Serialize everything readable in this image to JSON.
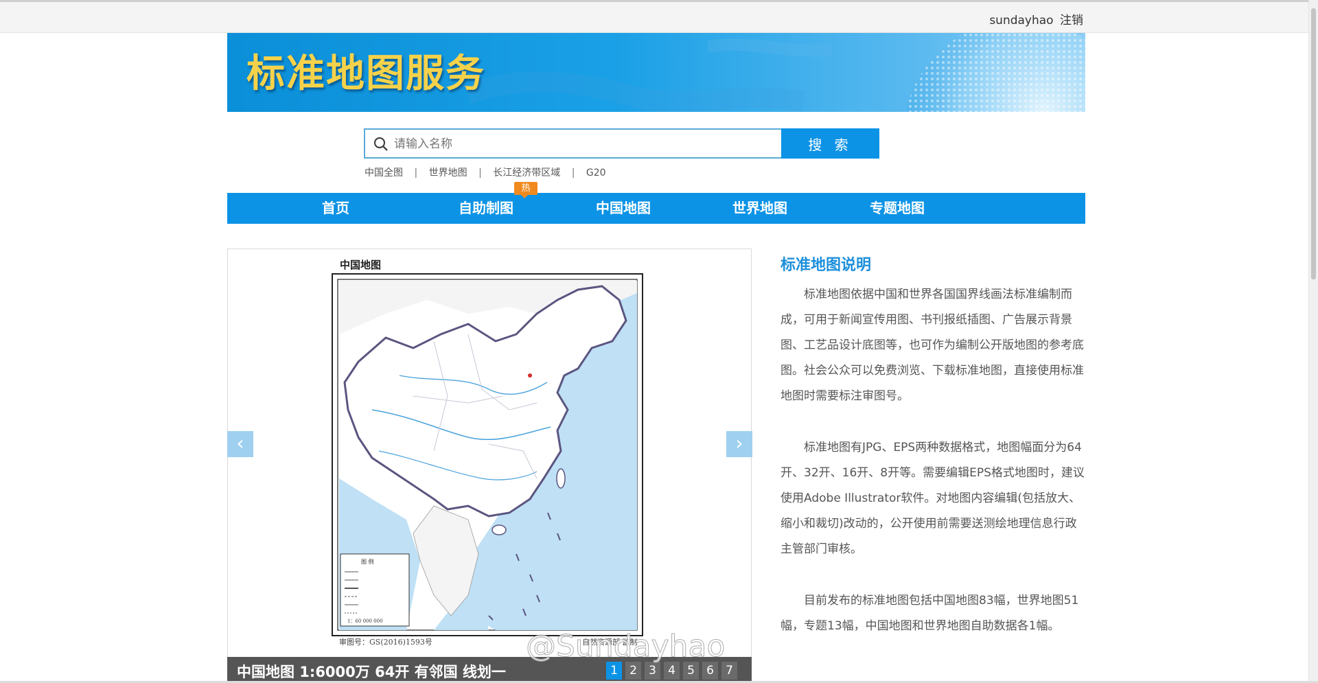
{
  "topbar": {
    "username": "sundayhao",
    "logout": "注销"
  },
  "banner": {
    "logo_text": "标准地图服务"
  },
  "search": {
    "placeholder": "请输入名称",
    "button_label": "搜 索"
  },
  "quick_links": [
    "中国全图",
    "世界地图",
    "长江经济带区域",
    "G20"
  ],
  "quick_links_separator": "|",
  "nav": {
    "items": [
      "首页",
      "自助制图",
      "中国地图",
      "世界地图",
      "专题地图"
    ],
    "hot_badge": "热"
  },
  "carousel": {
    "map_title": "中国地图",
    "approval_number": "审图号：GS(2016)1593号",
    "publisher": "自然资源部 监制",
    "caption": "中国地图 1:6000万 64开 有邻国 线划一",
    "pages": [
      "1",
      "2",
      "3",
      "4",
      "5",
      "6",
      "7"
    ],
    "active_page": 1,
    "prev_arrow": "‹",
    "next_arrow": "›",
    "legend_title": "图 例",
    "scale": "1：60 000 000"
  },
  "watermark": "@Sundayhao",
  "description": {
    "title": "标准地图说明",
    "paragraphs": [
      "标准地图依据中国和世界各国国界线画法标准编制而成，可用于新闻宣传用图、书刊报纸插图、广告展示背景图、工艺品设计底图等，也可作为编制公开版地图的参考底图。社会公众可以免费浏览、下载标准地图，直接使用标准地图时需要标注审图号。",
      "标准地图有JPG、EPS两种数据格式，地图幅面分为64开、32开、16开、8开等。需要编辑EPS格式地图时，建议使用Adobe Illustrator软件。对地图内容编辑(包括放大、缩小和裁切)改动的，公开使用前需要送测绘地理信息行政主管部门审核。",
      "目前发布的标准地图包括中国地图83幅，世界地图51幅，专题13幅，中国地图和世界地图自助数据各1幅。"
    ]
  },
  "colors": {
    "primary_blue": "#0c93e6",
    "hot_orange": "#f08a1f",
    "title_blue": "#1c8fdc",
    "logo_yellow": "#f6d24a"
  }
}
